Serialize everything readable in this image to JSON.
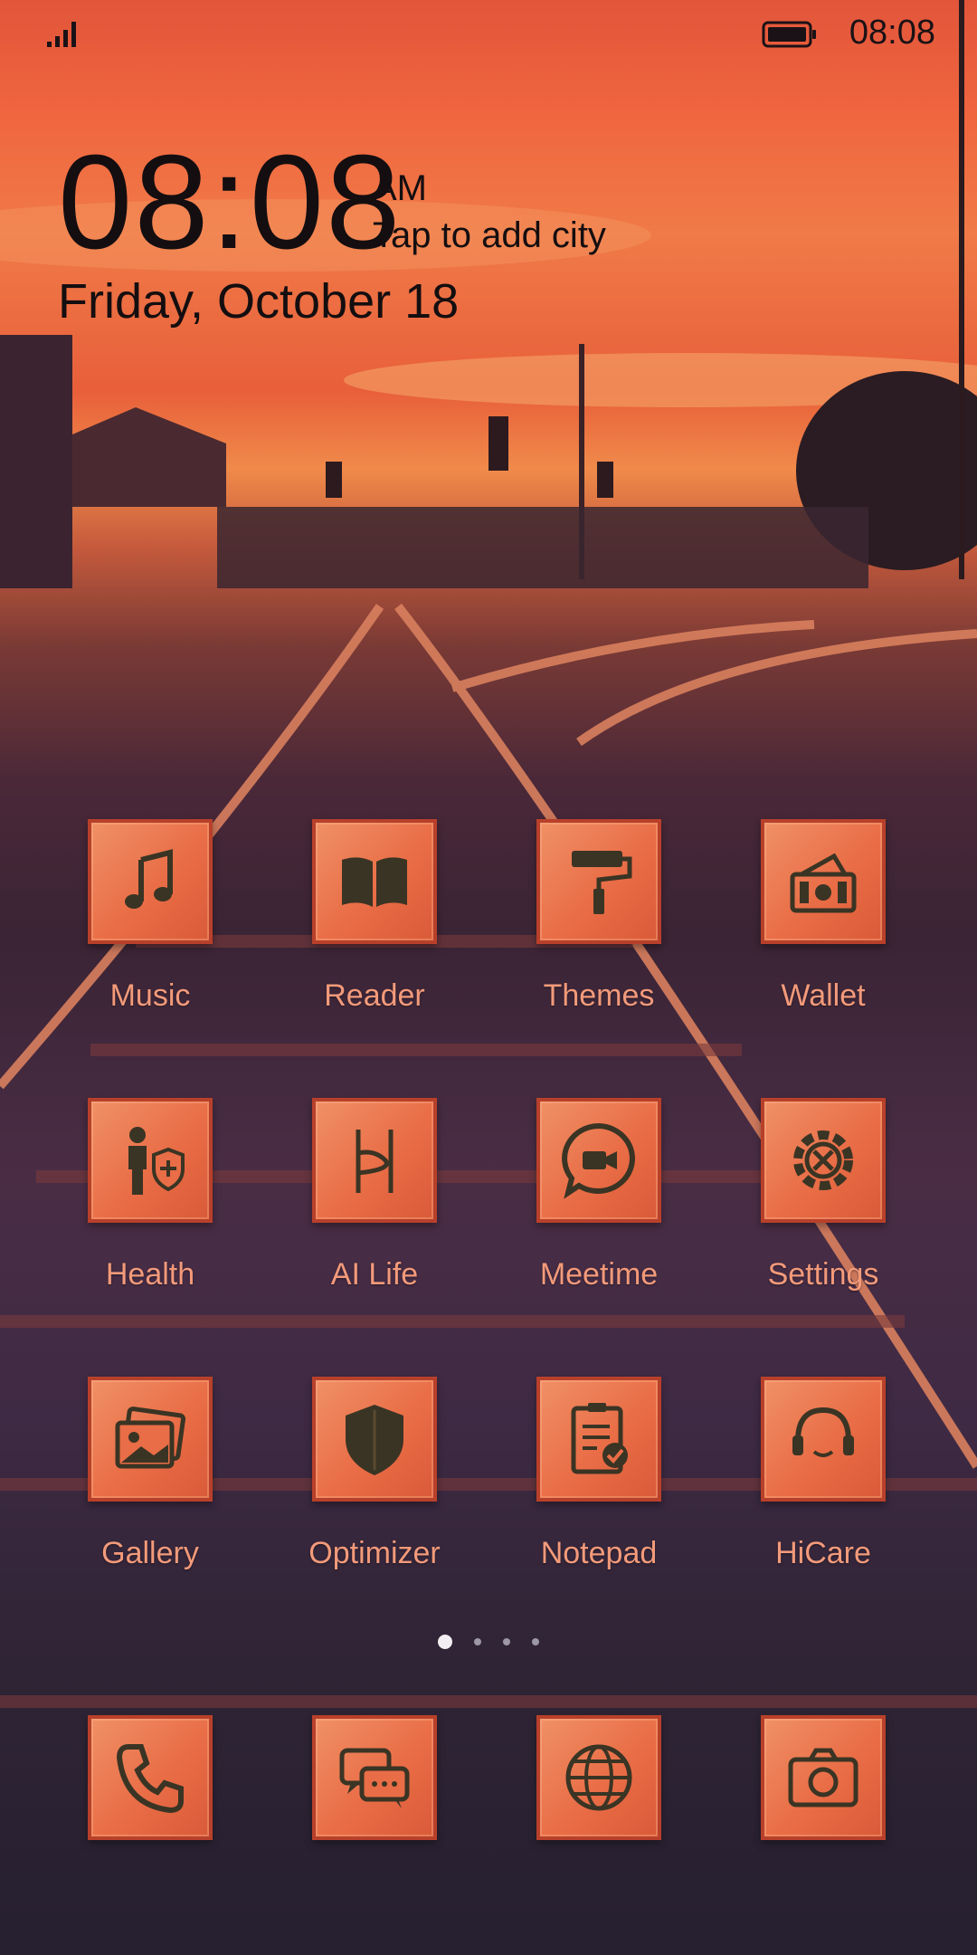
{
  "status": {
    "time": "08:08",
    "signal_icon": "signal-icon",
    "battery_icon": "battery-icon"
  },
  "lock": {
    "clock": "08:08",
    "ampm": "AM",
    "city_prompt": "Tap to add city",
    "date": "Friday, October 18"
  },
  "apps": [
    {
      "label": "Music",
      "icon": "music-note-icon"
    },
    {
      "label": "Reader",
      "icon": "book-icon"
    },
    {
      "label": "Themes",
      "icon": "paint-roller-icon"
    },
    {
      "label": "Wallet",
      "icon": "wallet-icon"
    },
    {
      "label": "Health",
      "icon": "health-icon"
    },
    {
      "label": "AI Life",
      "icon": "ai-life-icon"
    },
    {
      "label": "Meetime",
      "icon": "video-chat-icon"
    },
    {
      "label": "Settings",
      "icon": "gear-icon"
    },
    {
      "label": "Gallery",
      "icon": "gallery-icon"
    },
    {
      "label": "Optimizer",
      "icon": "shield-icon"
    },
    {
      "label": "Notepad",
      "icon": "notepad-icon"
    },
    {
      "label": "HiCare",
      "icon": "headset-icon"
    }
  ],
  "dock": [
    {
      "icon": "phone-icon"
    },
    {
      "icon": "messages-icon"
    },
    {
      "icon": "browser-globe-icon"
    },
    {
      "icon": "camera-icon"
    }
  ],
  "pager": {
    "pages": 4,
    "active": 1
  },
  "colors": {
    "tile": "#e96d46",
    "tile_border": "#b8402a",
    "label": "#f39a7a",
    "glyph": "#3a3424"
  }
}
